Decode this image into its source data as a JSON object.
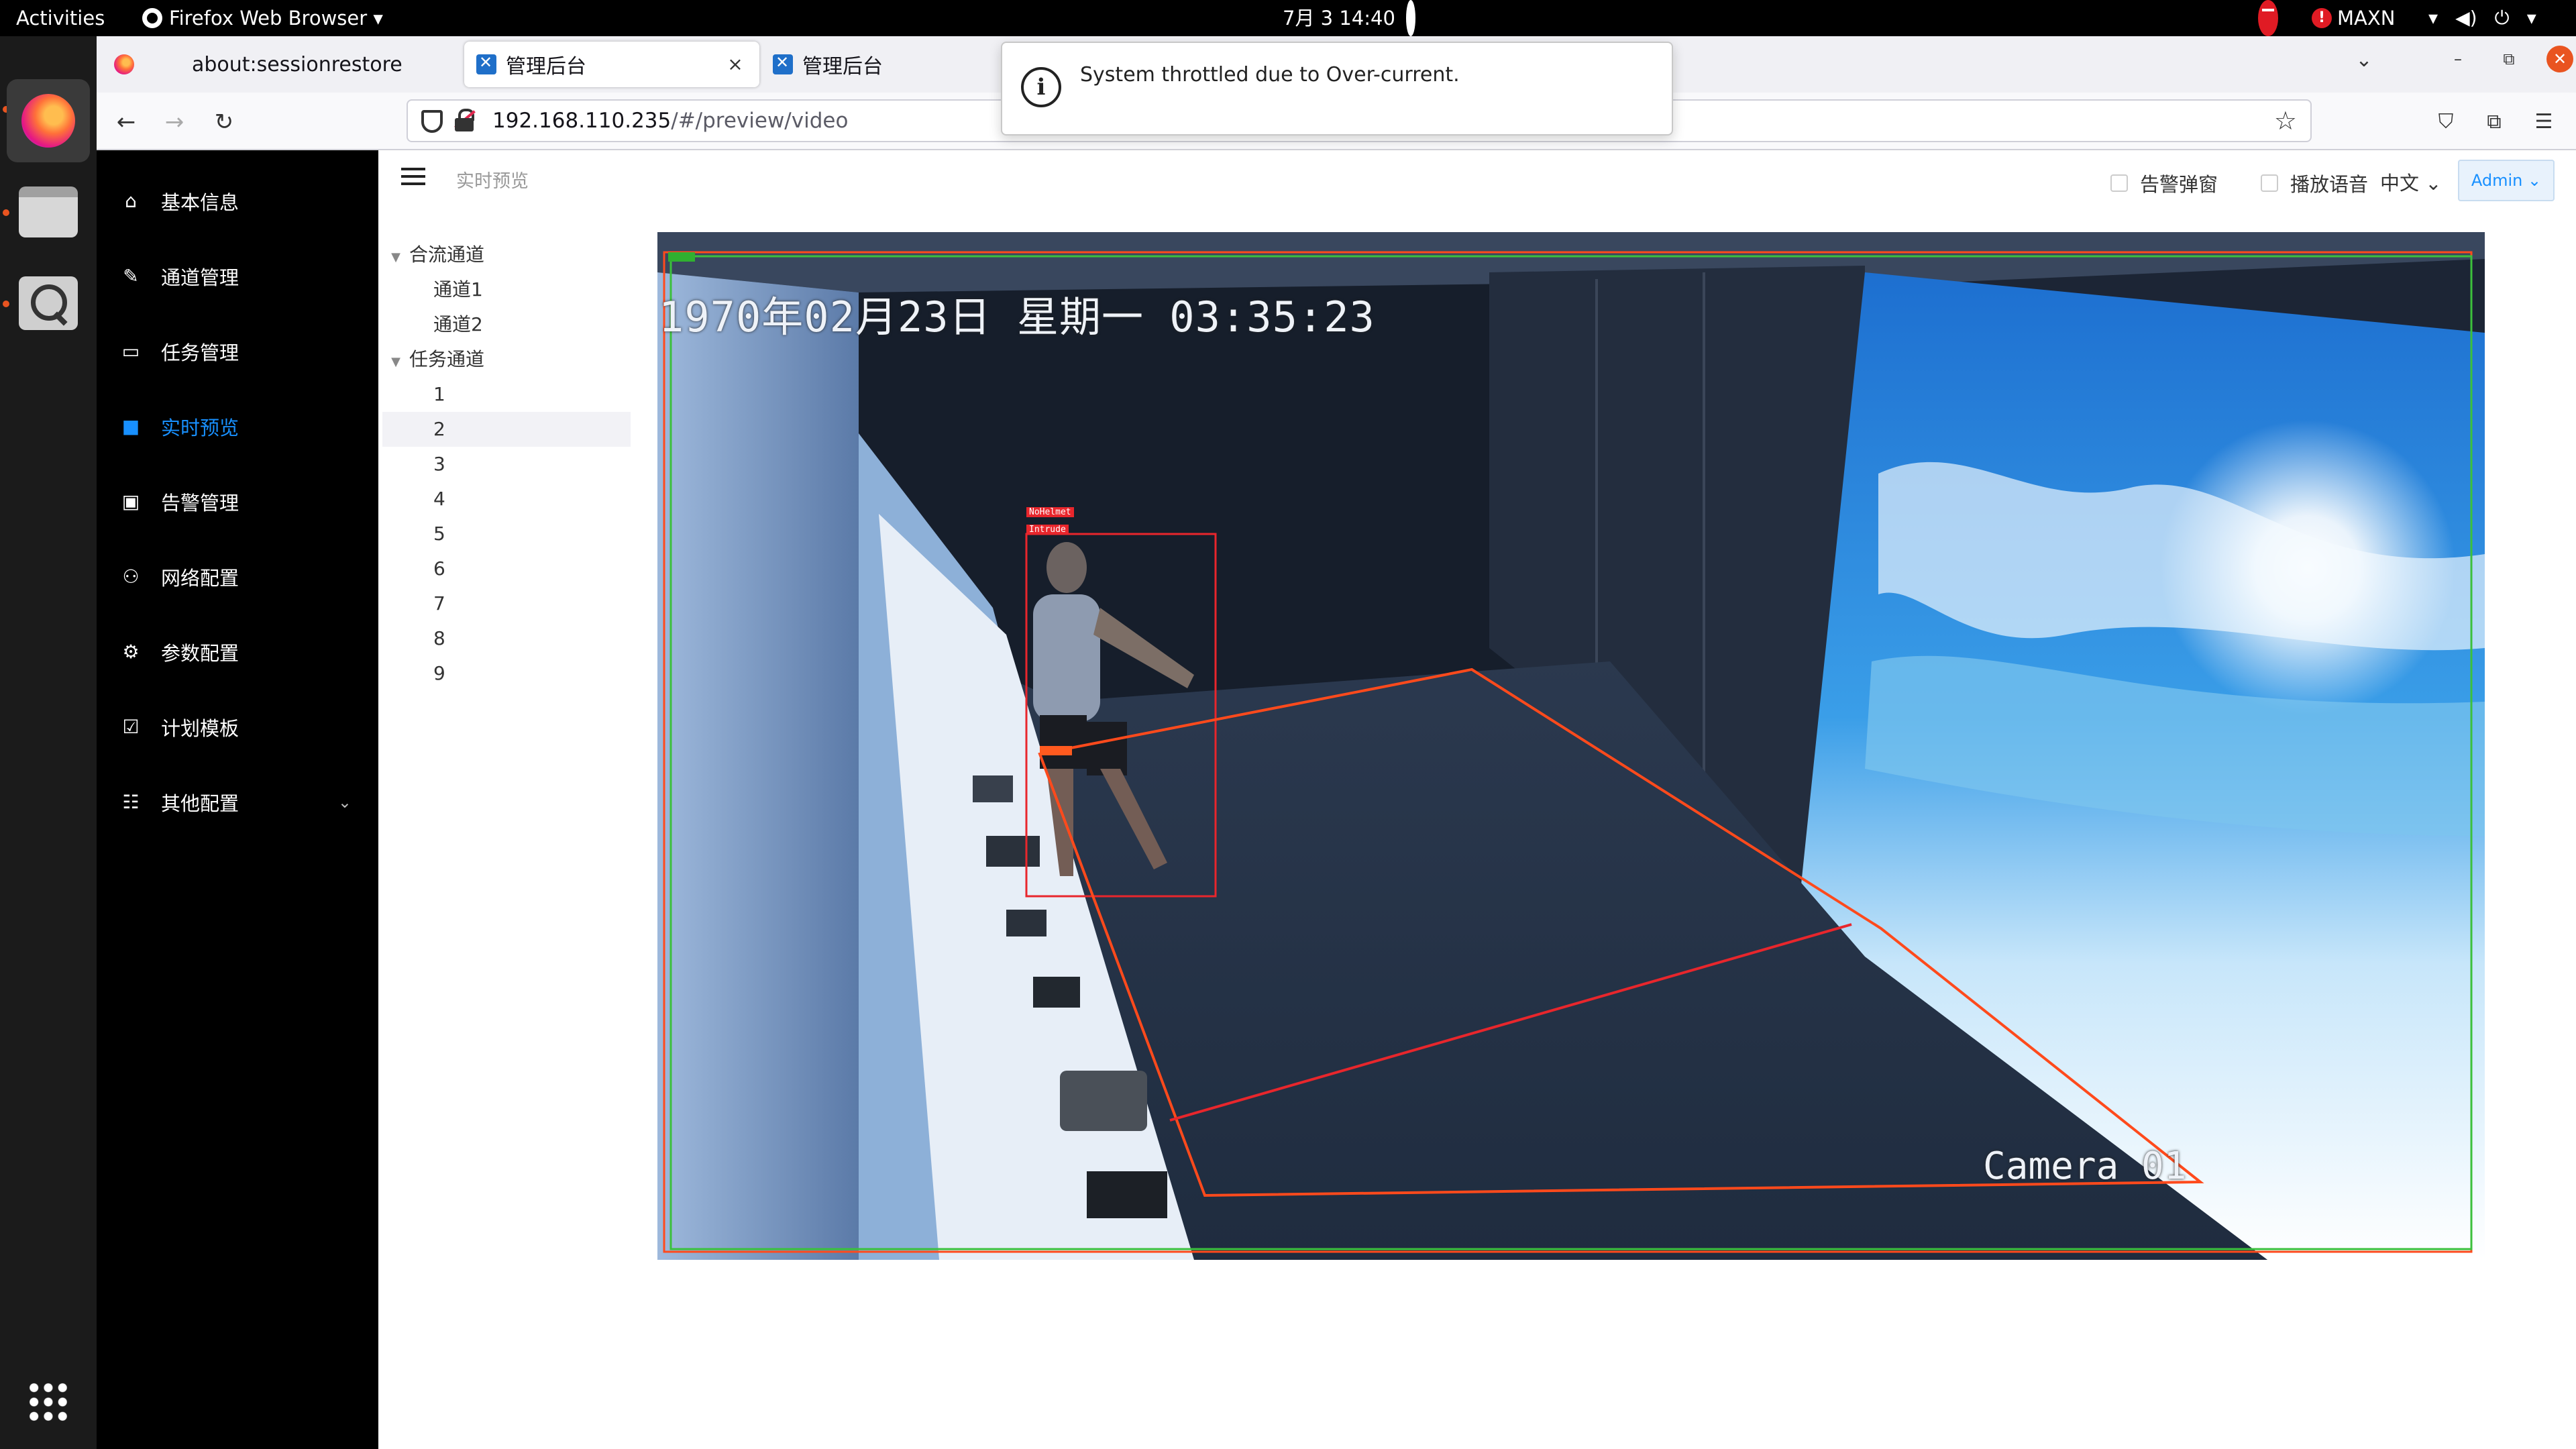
{
  "topbar": {
    "activities": "Activities",
    "app_name": "Firefox Web Browser ▾",
    "clock": "7月 3  14:40",
    "status_label": "MAXN",
    "status_warn": "!"
  },
  "browser": {
    "tabs": [
      {
        "label": "about:sessionrestore",
        "close": "×"
      },
      {
        "label": "管理后台",
        "close": "×"
      },
      {
        "label": "管理后台"
      }
    ],
    "url_host": "192.168.110.235",
    "url_path": "/#/preview/video"
  },
  "notification": {
    "message": "System throttled due to Over-current."
  },
  "sidebar": {
    "items": [
      {
        "label": "基本信息",
        "icon": "home-icon"
      },
      {
        "label": "通道管理",
        "icon": "channel-icon"
      },
      {
        "label": "任务管理",
        "icon": "task-icon"
      },
      {
        "label": "实时预览",
        "icon": "preview-icon"
      },
      {
        "label": "告警管理",
        "icon": "alarm-icon"
      },
      {
        "label": "网络配置",
        "icon": "network-icon"
      },
      {
        "label": "参数配置",
        "icon": "settings-icon"
      },
      {
        "label": "计划模板",
        "icon": "calendar-check-icon"
      },
      {
        "label": "其他配置",
        "icon": "sliders-icon"
      }
    ],
    "active_color": "#1890ff"
  },
  "header": {
    "breadcrumb": "实时预览",
    "alarm_popup": "告警弹窗",
    "play_voice": "播放语音",
    "language": "中文",
    "user": "Admin"
  },
  "tree": {
    "merged_group": "合流通道",
    "merged": [
      "通道1",
      "通道2"
    ],
    "task_group": "任务通道",
    "tasks": [
      "1",
      "2",
      "3",
      "4",
      "5",
      "6",
      "7",
      "8",
      "9"
    ]
  },
  "video": {
    "osd_time": "1970年02月23日 星期一 03:35:23",
    "osd_camera": "Camera 01",
    "tags": {
      "nohelmet": "NoHelmet",
      "intrude": "Intrude"
    },
    "colors": {
      "zone": "#ff4a1c",
      "detect_box": "#e8262c",
      "frame_green": "#3cc03c"
    }
  }
}
